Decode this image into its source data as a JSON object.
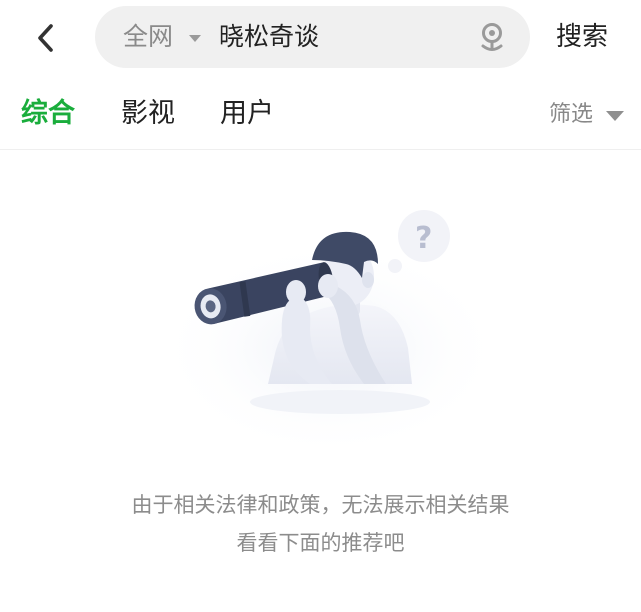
{
  "topbar": {
    "scope_label": "全网",
    "query": "晓松奇谈",
    "search_label": "搜索"
  },
  "tabs": [
    {
      "label": "综合",
      "active": true
    },
    {
      "label": "影视",
      "active": false
    },
    {
      "label": "用户",
      "active": false
    }
  ],
  "filter": {
    "label": "筛选"
  },
  "empty_state": {
    "line1": "由于相关法律和政策，无法展示相关结果",
    "line2": "看看下面的推荐吧"
  },
  "colors": {
    "accent": "#1aad3c",
    "search_bg": "#f0f0f0",
    "muted_text": "#8c8c8c"
  },
  "icons": [
    "chevron-left-icon",
    "caret-down-icon",
    "microphone-icon",
    "filter-caret-icon",
    "telescope-person-illustration"
  ]
}
